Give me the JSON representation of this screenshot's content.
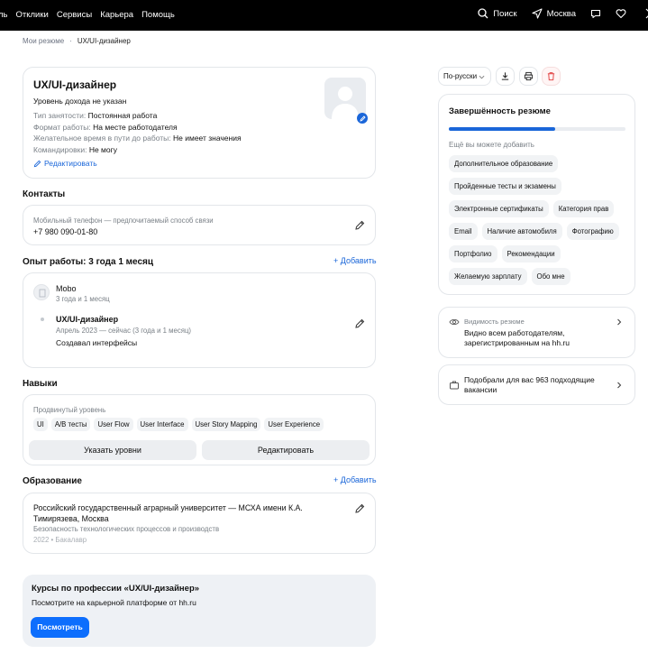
{
  "topbar": {
    "nav": [
      "ль",
      "Отклики",
      "Сервисы",
      "Карьера",
      "Помощь"
    ],
    "search_label": "Поиск",
    "city_label": "Москва"
  },
  "breadcrumb": {
    "root": "Мои резюме",
    "current": "UX/UI-дизайнер"
  },
  "profile": {
    "title": "UX/UI-дизайнер",
    "income": "Уровень дохода не указан",
    "rows": [
      {
        "label": "Тип занятости:",
        "value": "Постоянная работа"
      },
      {
        "label": "Формат работы:",
        "value": "На месте работодателя"
      },
      {
        "label": "Желательное время в пути до работы:",
        "value": "Не имеет значения"
      },
      {
        "label": "Командировки:",
        "value": "Не могу"
      }
    ],
    "edit_label": "Редактировать"
  },
  "contacts": {
    "heading": "Контакты",
    "caption": "Мобильный телефон — предпочитаемый способ связи",
    "phone": "+7 980 090-01-80"
  },
  "experience": {
    "heading": "Опыт работы: 3 года 1 месяц",
    "add_label": "+ Добавить",
    "company": "Mobo",
    "company_duration": "3 года и 1 месяц",
    "position": "UX/UI-дизайнер",
    "period": "Апрель 2023 — сейчас (3 года и 1 месяц)",
    "description": "Создавал интерфейсы"
  },
  "skills": {
    "heading": "Навыки",
    "level": "Продвинутый уровень",
    "tags": [
      "UI",
      "A/B тесты",
      "User Flow",
      "User Interface",
      "User Story Mapping",
      "User Experience"
    ],
    "btn_levels": "Указать уровни",
    "btn_edit": "Редактировать"
  },
  "education": {
    "heading": "Образование",
    "add_label": "+ Добавить",
    "university": "Российский государственный аграрный университет — МСХА имени К.А. Тимирязева, Москва",
    "faculty": "Безопасность технологических процессов и производств",
    "year": "2022 • Бакалавр"
  },
  "courses": {
    "title": "Курсы по профессии «UX/UI-дизайнер»",
    "subtitle": "Посмотрите на карьерной платформе от hh.ru",
    "button": "Посмотреть"
  },
  "sidebar": {
    "language": "По-русски",
    "completeness": {
      "title": "Завершённость резюме",
      "progress": 0.6,
      "caption": "Ещё вы можете добавить",
      "chips": [
        "Дополнительное образование",
        "Пройденные тесты и экзамены",
        "Электронные сертификаты",
        "Категория прав",
        "Email",
        "Наличие автомобиля",
        "Фотографию",
        "Портфолио",
        "Рекомендации",
        "Желаемую зарплату",
        "Обо мне"
      ]
    },
    "visibility": {
      "caption": "Видимость резюме",
      "text": "Видно всем работодателям, зарегистрированным на hh.ru"
    },
    "vacancies": {
      "text": "Подобрали для вас 963 подходящие вакансии"
    }
  },
  "colors": {
    "accent": "#1a66d9",
    "progress": "#1a66d9",
    "delete": "#e34a4a"
  }
}
